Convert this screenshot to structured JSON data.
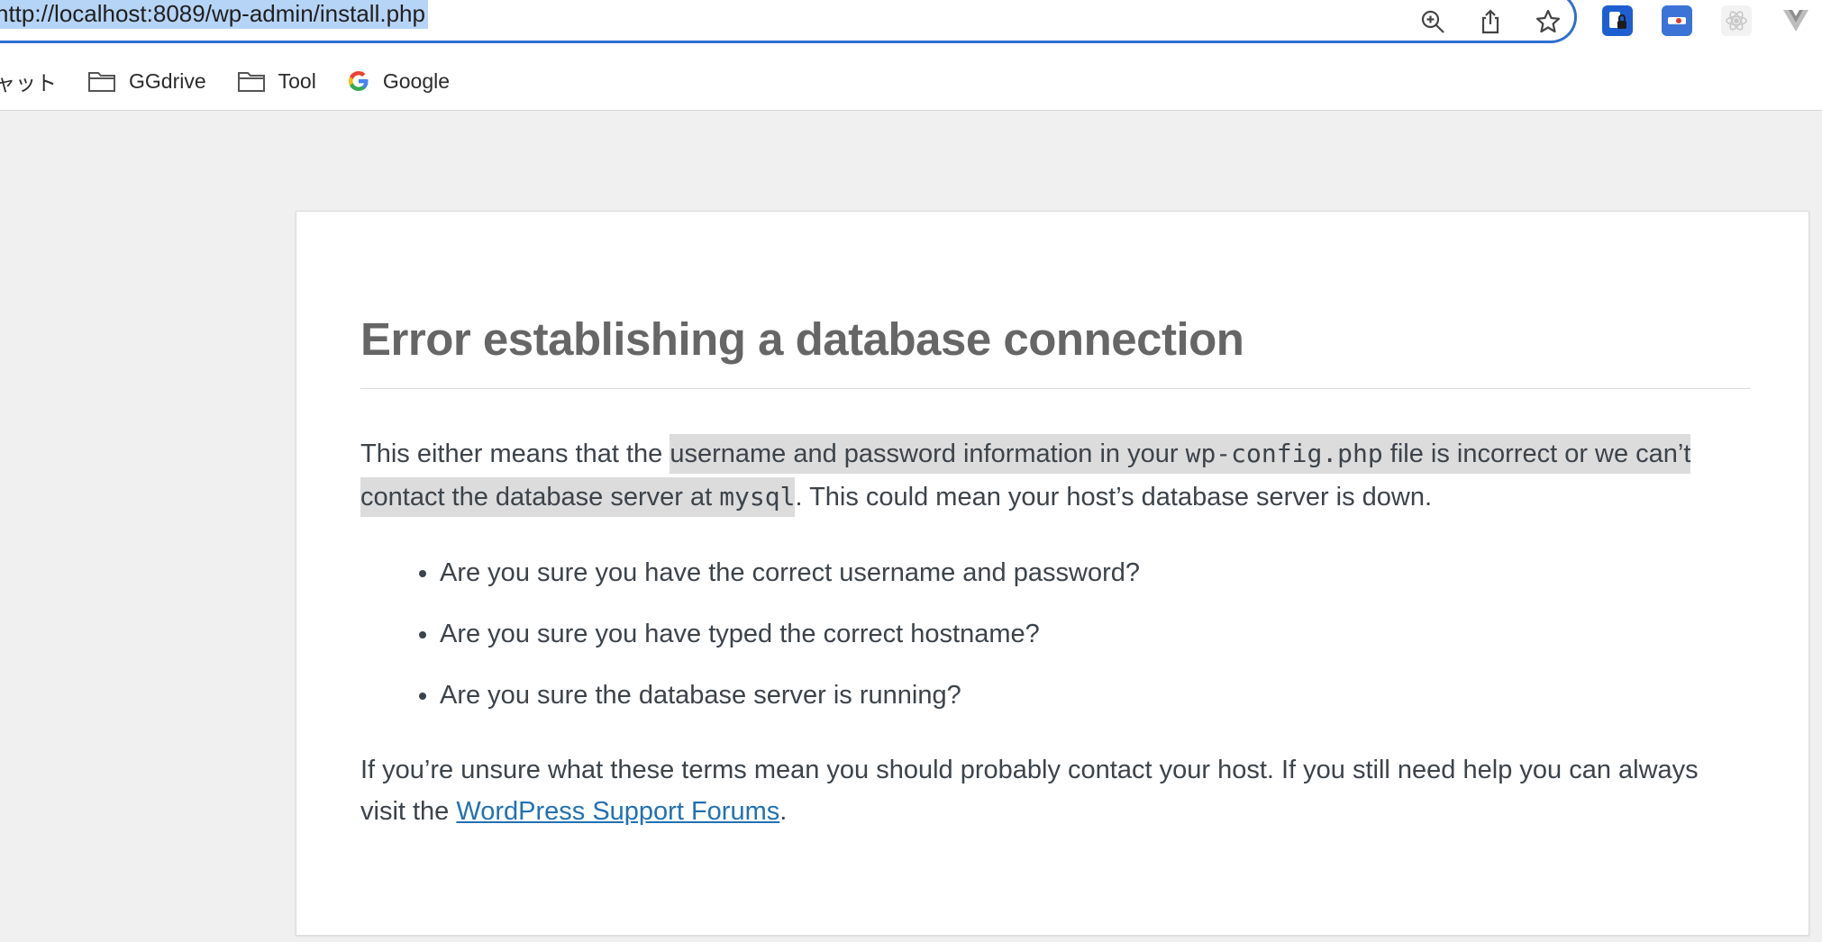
{
  "browser": {
    "url": "http://localhost:8089/wp-admin/install.php",
    "actions": {
      "zoom_icon": "zoom-in-icon",
      "share_icon": "share-icon",
      "bookmark_icon": "star-icon"
    },
    "extensions": [
      "password-manager-extension-icon",
      "tag-assistant-extension-icon",
      "react-devtools-extension-icon",
      "vue-devtools-extension-icon"
    ]
  },
  "bookmarks": {
    "truncated_label": "ャット",
    "items": [
      {
        "label": "GGdrive",
        "icon": "folder-icon"
      },
      {
        "label": "Tool",
        "icon": "folder-icon"
      },
      {
        "label": "Google",
        "icon": "google-icon"
      }
    ]
  },
  "error": {
    "title": "Error establishing a database connection",
    "para1": {
      "intro": "This either means that the ",
      "hl_part1": "username and password information in your ",
      "config_file": "wp-config.php",
      "hl_part2": " file is incorrect or we can’t contact the database server at ",
      "server": "mysql",
      "end": ". This could mean your host’s database server is down."
    },
    "checks": [
      "Are you sure you have the correct username and password?",
      "Are you sure you have typed the correct hostname?",
      "Are you sure the database server is running?"
    ],
    "para2": {
      "text": "If you’re unsure what these terms mean you should probably contact your host. If you still need help you can always visit the ",
      "link_text": "WordPress Support Forums",
      "end": "."
    }
  },
  "colors": {
    "link": "#2271b1",
    "title": "#666666",
    "body_text": "#3c434a",
    "url_focus": "#2f6fd0"
  }
}
